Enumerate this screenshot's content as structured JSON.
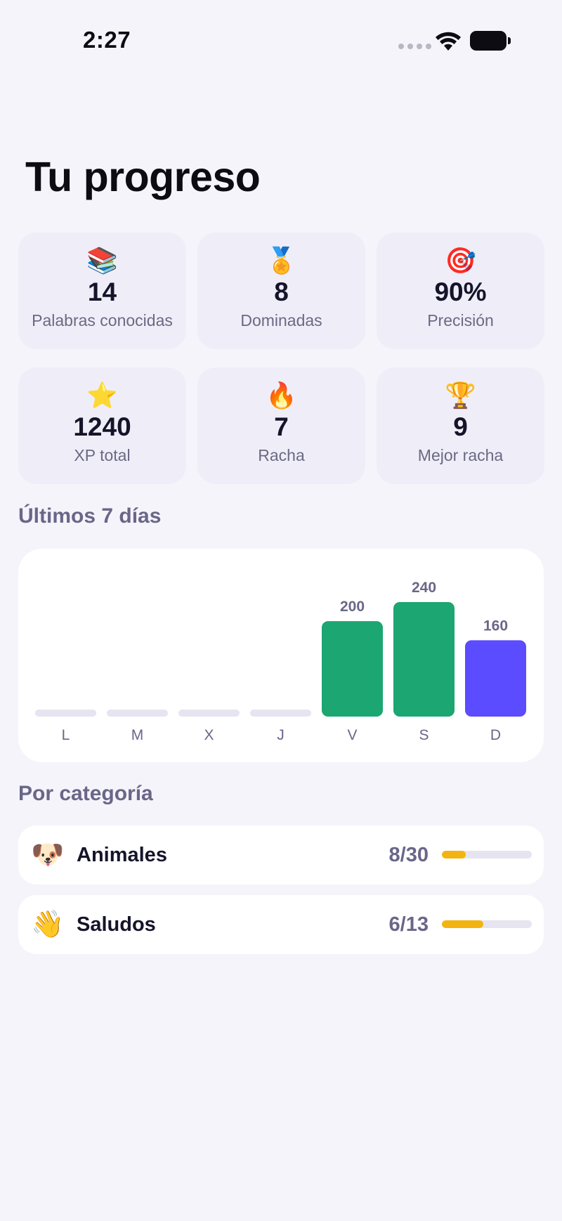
{
  "status_bar": {
    "time": "2:27"
  },
  "page": {
    "title": "Tu progreso"
  },
  "stats": [
    {
      "icon": "books-icon",
      "glyph": "📚",
      "value": "14",
      "label": "Palabras conocidas"
    },
    {
      "icon": "medal-icon",
      "glyph": "🏅",
      "value": "8",
      "label": "Dominadas"
    },
    {
      "icon": "target-icon",
      "glyph": "🎯",
      "value": "90%",
      "label": "Precisión"
    },
    {
      "icon": "star-icon",
      "glyph": "⭐",
      "value": "1240",
      "label": "XP total"
    },
    {
      "icon": "fire-icon",
      "glyph": "🔥",
      "value": "7",
      "label": "Racha"
    },
    {
      "icon": "trophy-icon",
      "glyph": "🏆",
      "value": "9",
      "label": "Mejor racha"
    }
  ],
  "sections": {
    "last7": "Últimos 7 días",
    "by_category": "Por categoría"
  },
  "chart_data": {
    "type": "bar",
    "categories": [
      "L",
      "M",
      "X",
      "J",
      "V",
      "S",
      "D"
    ],
    "values": [
      0,
      0,
      0,
      0,
      200,
      240,
      160
    ],
    "data_labels": [
      "",
      "",
      "",
      "",
      "200",
      "240",
      "160"
    ],
    "ylim": [
      0,
      240
    ],
    "colors": {
      "past": "#1ba672",
      "today": "#5b4cff",
      "empty": "#e6e4f0",
      "label": "#6a6688"
    },
    "highlight_index": 6
  },
  "categories": [
    {
      "icon": "dog-face-icon",
      "glyph": "🐶",
      "name": "Animales",
      "count": "8/30",
      "progress": 0.267
    },
    {
      "icon": "waving-hand-icon",
      "glyph": "👋",
      "name": "Saludos",
      "count": "6/13",
      "progress": 0.462
    }
  ]
}
